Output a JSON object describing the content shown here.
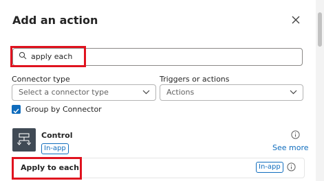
{
  "dialog": {
    "title": "Add an action"
  },
  "search": {
    "value": "apply each"
  },
  "filters": {
    "connector_label": "Connector type",
    "connector_placeholder": "Select a connector type",
    "triggers_label": "Triggers or actions",
    "triggers_value": "Actions"
  },
  "group_by": {
    "label": "Group by Connector",
    "checked": true
  },
  "connector": {
    "name": "Control",
    "badge": "In-app",
    "see_more": "See more"
  },
  "actions": [
    {
      "label": "Apply to each",
      "badge": "In-app"
    }
  ],
  "colors": {
    "accent": "#0f6cbd",
    "highlight": "#e0121e",
    "connector_icon_bg": "#404a55"
  },
  "icons": {
    "close": "close-icon",
    "search": "search-icon",
    "chevron": "chevron-down-icon",
    "check": "checkmark-icon",
    "connector": "control-flow-icon",
    "info": "info-icon"
  }
}
